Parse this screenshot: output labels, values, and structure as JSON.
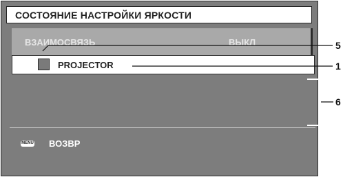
{
  "window": {
    "title": "СОСТОЯНИЕ НАСТРОЙКИ ЯРКОСТИ"
  },
  "link": {
    "label": "ВЗАИМОСВЯЗЬ",
    "value": "ВЫКЛ"
  },
  "projector": {
    "label": "PROJECTOR"
  },
  "footer": {
    "menu_key": "MENU",
    "back_label": "ВОЗВР"
  },
  "callouts": {
    "five": "5",
    "one": "1",
    "six": "6"
  },
  "colors": {
    "osd_background": "#7d7d7d",
    "header_background": "#ffffff",
    "inactive_text": "#e6e6e6",
    "highlight_row": "#ffffff"
  }
}
